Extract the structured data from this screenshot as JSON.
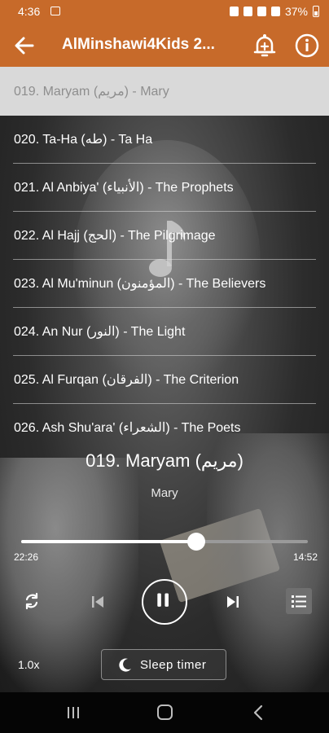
{
  "status_bar": {
    "time": "4:36",
    "battery": "37%"
  },
  "app_bar": {
    "title": "AlMinshawi4Kids 2..."
  },
  "tracks": [
    {
      "label": "019. Maryam (مريم) - Mary"
    },
    {
      "label": "020. Ta-Ha (طه) - Ta Ha"
    },
    {
      "label": "021. Al Anbiya' (الأنبياء) - The Prophets"
    },
    {
      "label": "022. Al Hajj (الحج) - The Pilgrimage"
    },
    {
      "label": "023. Al Mu'minun (المؤمنون) - The Believers"
    },
    {
      "label": "024. An Nur (النور) - The Light"
    },
    {
      "label": "025. Al Furqan (الفرقان) - The Criterion"
    },
    {
      "label": "026. Ash Shu'ara' (الشعراء) - The Poets"
    }
  ],
  "now_playing": {
    "title": "019. Maryam (مريم)",
    "subtitle": "Mary",
    "elapsed": "22:26",
    "duration": "14:52",
    "progress": 0.61
  },
  "controls": {
    "speed": "1.0x",
    "sleep_timer": "Sleep timer"
  },
  "colors": {
    "accent": "#c76a2a",
    "current_row": "#d9d9d9"
  },
  "icons": [
    "back-arrow-icon",
    "bell-add-icon",
    "info-icon",
    "music-note-icon",
    "repeat-icon",
    "previous-icon",
    "pause-icon",
    "next-icon",
    "queue-icon",
    "moon-icon"
  ]
}
